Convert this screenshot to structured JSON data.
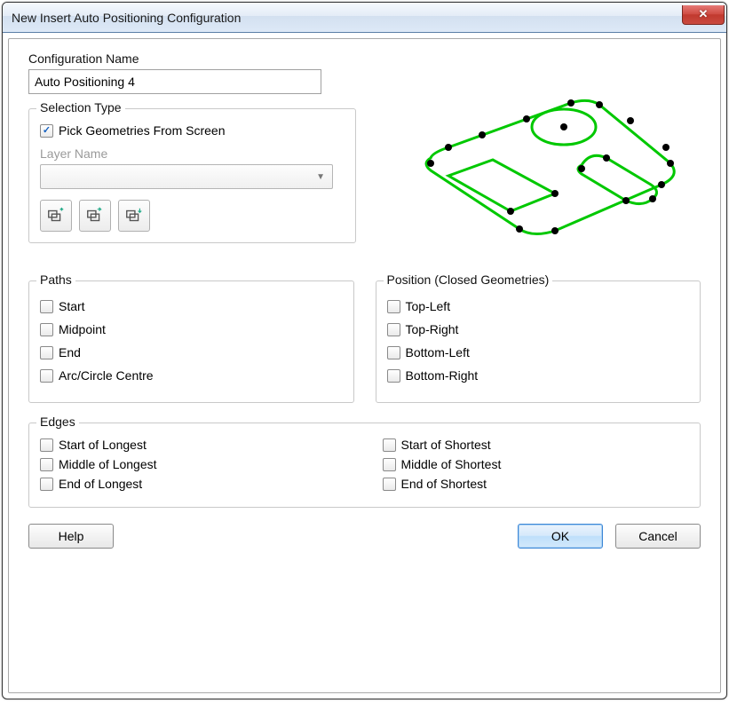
{
  "window": {
    "title": "New Insert Auto Positioning Configuration"
  },
  "config": {
    "name_label": "Configuration Name",
    "name_value": "Auto Positioning 4"
  },
  "selection": {
    "legend": "Selection Type",
    "pick_label": "Pick Geometries From Screen",
    "pick_checked": true,
    "layer_label": "Layer Name",
    "layer_value": ""
  },
  "paths": {
    "legend": "Paths",
    "items": [
      {
        "label": "Start",
        "checked": false
      },
      {
        "label": "Midpoint",
        "checked": false
      },
      {
        "label": "End",
        "checked": false
      },
      {
        "label": "Arc/Circle Centre",
        "checked": false
      }
    ]
  },
  "position": {
    "legend": "Position (Closed Geometries)",
    "items": [
      {
        "label": "Top-Left",
        "checked": false
      },
      {
        "label": "Top-Right",
        "checked": false
      },
      {
        "label": "Bottom-Left",
        "checked": false
      },
      {
        "label": "Bottom-Right",
        "checked": false
      }
    ]
  },
  "edges": {
    "legend": "Edges",
    "left": [
      {
        "label": "Start of Longest",
        "checked": false
      },
      {
        "label": "Middle of Longest",
        "checked": false
      },
      {
        "label": "End of Longest",
        "checked": false
      }
    ],
    "right": [
      {
        "label": "Start of Shortest",
        "checked": false
      },
      {
        "label": "Middle of Shortest",
        "checked": false
      },
      {
        "label": "End of Shortest",
        "checked": false
      }
    ]
  },
  "buttons": {
    "help": "Help",
    "ok": "OK",
    "cancel": "Cancel"
  },
  "toolbar_icons": [
    "layer-add-icon",
    "layer-copy-icon",
    "layer-move-icon"
  ]
}
